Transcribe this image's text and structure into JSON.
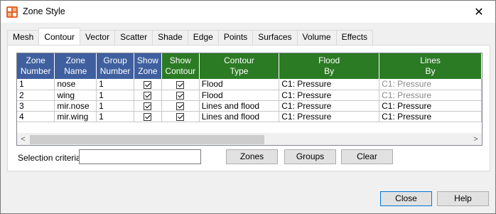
{
  "window": {
    "title": "Zone Style",
    "close_glyph": "✕"
  },
  "tabs": [
    {
      "label": "Mesh",
      "active": false
    },
    {
      "label": "Contour",
      "active": true
    },
    {
      "label": "Vector",
      "active": false
    },
    {
      "label": "Scatter",
      "active": false
    },
    {
      "label": "Shade",
      "active": false
    },
    {
      "label": "Edge",
      "active": false
    },
    {
      "label": "Points",
      "active": false
    },
    {
      "label": "Surfaces",
      "active": false
    },
    {
      "label": "Volume",
      "active": false
    },
    {
      "label": "Effects",
      "active": false
    }
  ],
  "grid": {
    "header_colors": {
      "blue": "#3f5f9f",
      "green": "#2b7a24"
    },
    "columns": [
      {
        "line1": "Zone",
        "line2": "Number"
      },
      {
        "line1": "Zone",
        "line2": "Name"
      },
      {
        "line1": "Group",
        "line2": "Number"
      },
      {
        "line1": "Show",
        "line2": "Zone"
      },
      {
        "line1": "Show",
        "line2": "Contour"
      },
      {
        "line1": "Contour",
        "line2": "Type"
      },
      {
        "line1": "Flood",
        "line2": "By"
      },
      {
        "line1": "Lines",
        "line2": "By"
      }
    ],
    "rows": [
      {
        "number": "1",
        "name": "nose",
        "group": "1",
        "show_zone": true,
        "show_contour": true,
        "type": "Flood",
        "flood_by": "C1: Pressure",
        "lines_by": "C1: Pressure",
        "lines_by_disabled": true
      },
      {
        "number": "2",
        "name": "wing",
        "group": "1",
        "show_zone": true,
        "show_contour": true,
        "type": "Flood",
        "flood_by": "C1: Pressure",
        "lines_by": "C1: Pressure",
        "lines_by_disabled": true
      },
      {
        "number": "3",
        "name": "mir.nose",
        "group": "1",
        "show_zone": true,
        "show_contour": true,
        "type": "Lines and flood",
        "flood_by": "C1: Pressure",
        "lines_by": "C1: Pressure",
        "lines_by_disabled": false
      },
      {
        "number": "4",
        "name": "mir.wing",
        "group": "1",
        "show_zone": true,
        "show_contour": true,
        "type": "Lines and flood",
        "flood_by": "C1: Pressure",
        "lines_by": "C1: Pressure",
        "lines_by_disabled": false
      }
    ],
    "scroll_left_glyph": "<",
    "scroll_right_glyph": ">"
  },
  "selection": {
    "label": "Selection criteria:",
    "value": "",
    "zones_label": "Zones",
    "groups_label": "Groups",
    "clear_label": "Clear"
  },
  "footer": {
    "close_label": "Close",
    "help_label": "Help"
  }
}
